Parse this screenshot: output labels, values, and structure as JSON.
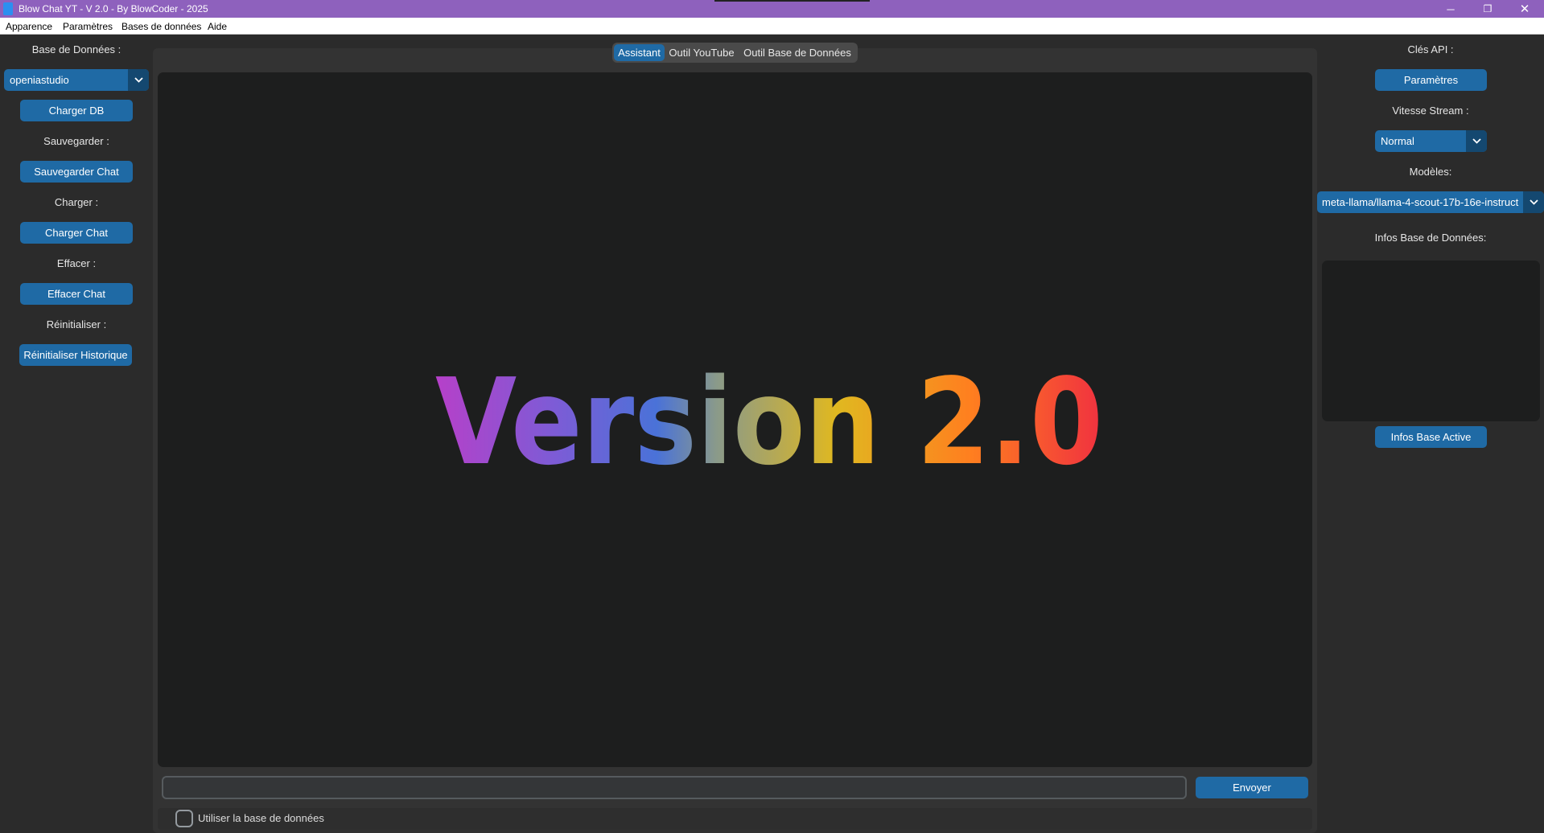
{
  "window": {
    "title": "Blow Chat YT - V 2.0 - By BlowCoder - 2025",
    "minimize_icon": "minimize-icon",
    "maximize_icon": "restore-icon",
    "close_icon": "close-icon",
    "min_glyph": "─",
    "max_glyph": "❐",
    "close_glyph": "✕"
  },
  "menubar": {
    "items": [
      "Apparence",
      "Paramètres",
      "Bases de données",
      "Aide"
    ]
  },
  "left_panel": {
    "db_label": "Base de Données :",
    "db_selected": "openiastudio",
    "load_db_button": "Charger DB",
    "save_label": "Sauvegarder :",
    "save_button": "Sauvegarder Chat",
    "load_label": "Charger :",
    "load_button": "Charger Chat",
    "clear_label": "Effacer :",
    "clear_button": "Effacer Chat",
    "reset_label": "Réinitialiser :",
    "reset_button": "Réinitialiser Historique"
  },
  "tabs": [
    {
      "label": "Assistant",
      "active": true
    },
    {
      "label": "Outil YouTube",
      "active": false
    },
    {
      "label": "Outil Base de Données",
      "active": false
    }
  ],
  "chat": {
    "splash_text": "Version 2.0",
    "input_value": "",
    "send_button": "Envoyer",
    "use_db_checkbox_label": "Utiliser la base de données",
    "use_db_checked": false
  },
  "right_panel": {
    "api_keys_label": "Clés API :",
    "params_button": "Paramètres",
    "stream_speed_label": "Vitesse Stream :",
    "stream_speed_selected": "Normal",
    "models_label": "Modèles:",
    "model_selected": "meta-llama/llama-4-scout-17b-16e-instruct",
    "db_info_label": "Infos Base de Données:",
    "active_base_button": "Infos Base Active"
  },
  "colors": {
    "titlebar": "#8e61bd",
    "accent": "#1f6aa5",
    "background": "#2b2b2b",
    "gradient": [
      "#b640c9",
      "#7c5cd6",
      "#4a72d8",
      "#8a9a8a",
      "#e0b820",
      "#ff7f1f",
      "#f03040"
    ]
  }
}
